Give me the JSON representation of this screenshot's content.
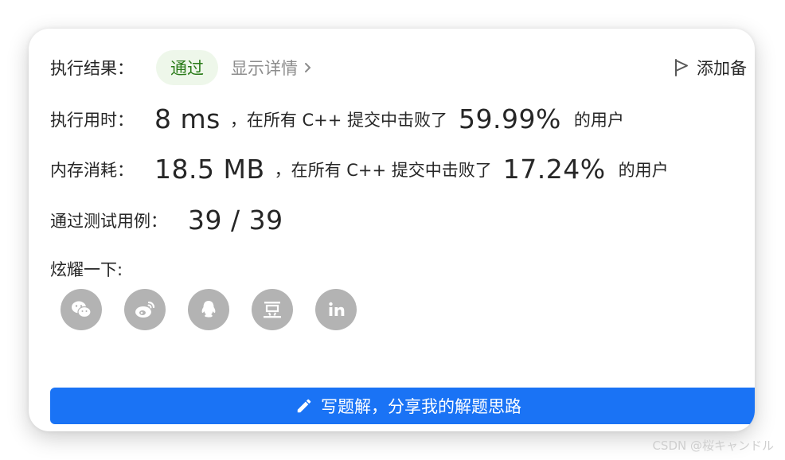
{
  "result": {
    "label": "执行结果：",
    "status": "通过",
    "details_link": "显示详情",
    "add_note": "添加备"
  },
  "runtime": {
    "label": "执行用时：",
    "value": "8 ms",
    "mid_text": "，在所有 C++ 提交中击败了",
    "percent": "59.99%",
    "suffix": "的用户"
  },
  "memory": {
    "label": "内存消耗：",
    "value": "18.5 MB",
    "mid_text": "，在所有 C++ 提交中击败了",
    "percent": "17.24%",
    "suffix": "的用户"
  },
  "tests": {
    "label": "通过测试用例：",
    "value": "39 / 39"
  },
  "share": {
    "label": "炫耀一下:",
    "icons": [
      "wechat-icon",
      "weibo-icon",
      "qq-icon",
      "douban-icon",
      "linkedin-icon"
    ]
  },
  "write_solution_button": "写题解，分享我的解题思路",
  "watermark": "CSDN @桜キャンドル",
  "colors": {
    "accent_blue": "#1a73f5",
    "pass_green": "#2a7b19",
    "pass_bg": "#eef7ea",
    "icon_gray": "#b3b3b3"
  }
}
